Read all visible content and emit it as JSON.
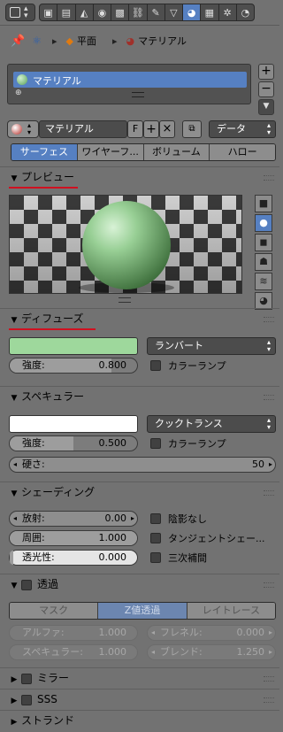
{
  "breadcrumb": {
    "object": "平面",
    "material": "マテリアル",
    "sep": "▸"
  },
  "material_list": {
    "items": [
      "マテリアル"
    ],
    "add": "+",
    "remove": "−",
    "menu": "▼"
  },
  "datablock": {
    "name": "マテリアル",
    "fake_user": "F",
    "plus": "+",
    "close": "×",
    "link_mode": "データ"
  },
  "type_tabs": [
    "サーフェス",
    "ワイヤーフ...",
    "ボリューム",
    "ハロー"
  ],
  "type_tabs_active": 0,
  "preview": {
    "title": "プレビュー"
  },
  "diffuse": {
    "title": "ディフューズ",
    "color": "#9ed89c",
    "shader": "ランバート",
    "intensity_label": "強度:",
    "intensity": "0.800",
    "ramp_label": "カラーランプ"
  },
  "specular": {
    "title": "スペキュラー",
    "color": "#ffffff",
    "shader": "クックトランス",
    "intensity_label": "強度:",
    "intensity": "0.500",
    "ramp_label": "カラーランプ",
    "hardness_label": "硬さ:",
    "hardness": "50"
  },
  "shading": {
    "title": "シェーディング",
    "emit_label": "放射:",
    "emit": "0.00",
    "ambient_label": "周囲:",
    "ambient": "1.000",
    "translucency_label": "透光性:",
    "translucency": "0.000",
    "shadeless": "陰影なし",
    "tangent": "タンジェントシェー...",
    "cubic": "三次補間"
  },
  "transparency": {
    "title": "透過",
    "tabs": [
      "マスク",
      "Z値透過",
      "レイトレース"
    ],
    "active_tab": 1,
    "alpha_label": "アルファ:",
    "alpha": "1.000",
    "fresnel_label": "フレネル:",
    "fresnel": "0.000",
    "specular_label": "スペキュラー:",
    "specular": "1.000",
    "blend_label": "ブレンド:",
    "blend": "1.250"
  },
  "collapsed_panels": [
    "ミラー",
    "SSS",
    "ストランド"
  ],
  "colors": {
    "accent": "#5680c2",
    "underline": "#d01020"
  }
}
